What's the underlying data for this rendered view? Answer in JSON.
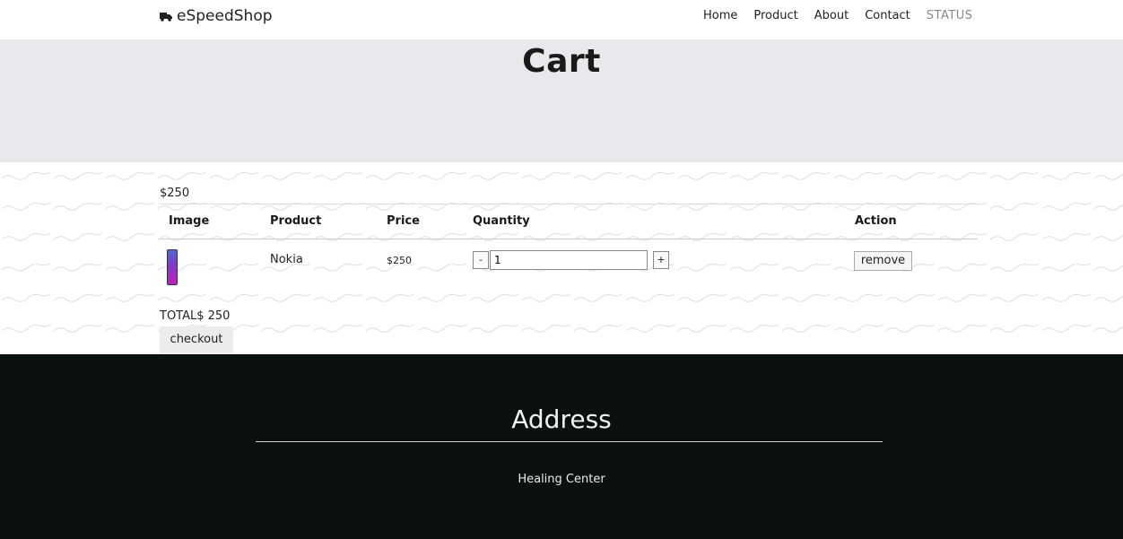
{
  "navbar": {
    "brand": "eSpeedShop",
    "links": [
      "Home",
      "Product",
      "About",
      "Contact"
    ],
    "status": "STATUS"
  },
  "hero": {
    "title": "Cart"
  },
  "cart": {
    "subtotal": "$250",
    "columns": [
      "Image",
      "Product",
      "Price",
      "Quantity",
      "Action"
    ],
    "items": [
      {
        "product": "Nokia",
        "price": "$250",
        "quantity": "1",
        "decrement": "-",
        "increment": "+",
        "action": "remove"
      }
    ],
    "total": "TOTAL$ 250",
    "checkout_label": "checkout"
  },
  "footer": {
    "heading": "Address",
    "address": "Healing Center"
  }
}
